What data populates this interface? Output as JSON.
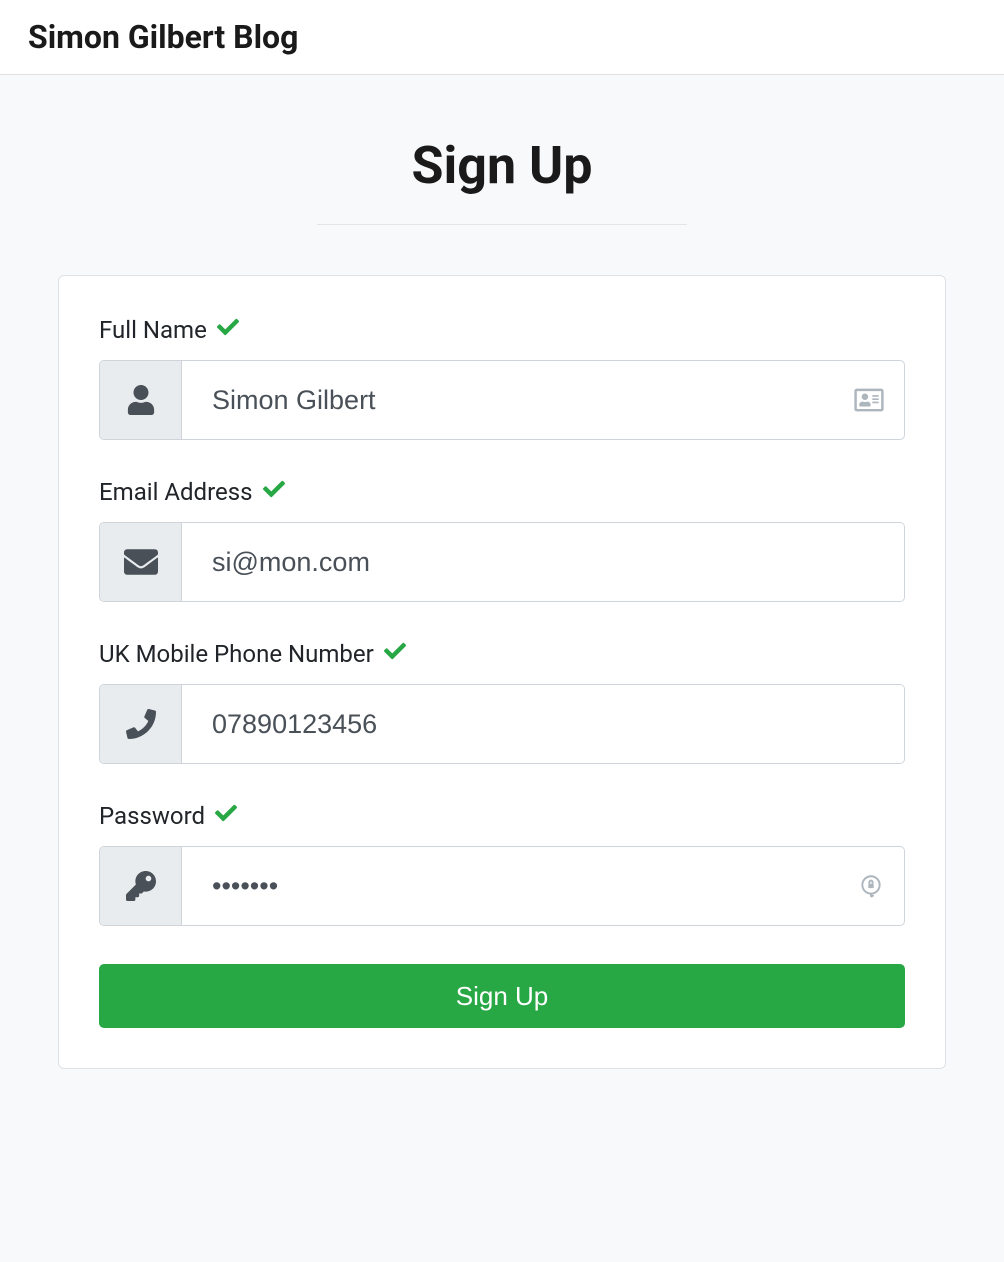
{
  "navbar": {
    "brand": "Simon Gilbert Blog"
  },
  "page": {
    "title": "Sign Up"
  },
  "form": {
    "fields": {
      "fullname": {
        "label": "Full Name",
        "value": "Simon Gilbert",
        "valid": true
      },
      "email": {
        "label": "Email Address",
        "value": "si@mon.com",
        "valid": true
      },
      "phone": {
        "label": "UK Mobile Phone Number",
        "value": "07890123456",
        "valid": true
      },
      "password": {
        "label": "Password",
        "value": "•••••••",
        "valid": true
      }
    },
    "submit_label": "Sign Up"
  }
}
